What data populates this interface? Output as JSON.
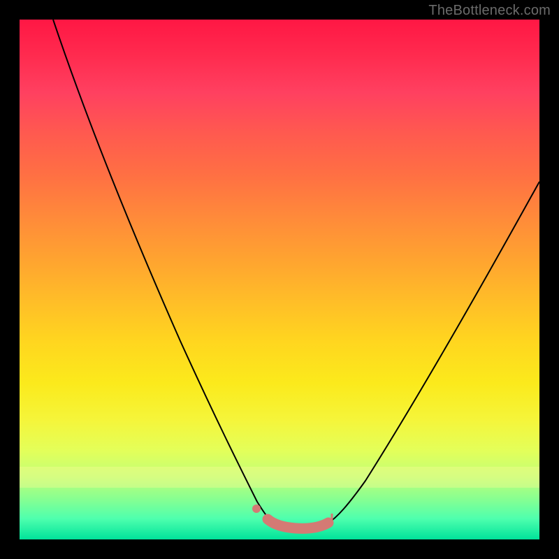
{
  "watermark": "TheBottleneck.com",
  "chart_data": {
    "type": "line",
    "title": "",
    "xlabel": "",
    "ylabel": "",
    "xlim": [
      0,
      100
    ],
    "ylim": [
      0,
      100
    ],
    "grid": false,
    "legend": false,
    "background": "heatmap-gradient-red-to-green-vertical",
    "series": [
      {
        "name": "bottleneck-curve",
        "color": "#000000",
        "x": [
          7,
          12,
          17,
          22,
          27,
          32,
          37,
          42,
          46,
          49,
          52,
          55,
          58,
          62,
          67,
          75,
          83,
          91,
          99
        ],
        "values": [
          100,
          87,
          75,
          62,
          50,
          38,
          27,
          16,
          8,
          4,
          2,
          2,
          4,
          8,
          15,
          27,
          41,
          55,
          69
        ]
      }
    ],
    "annotations": [
      {
        "type": "highlight-segment",
        "note": "optimal-range-marker",
        "color": "#d47a74",
        "x_start": 47,
        "x_end": 60,
        "y": 3
      },
      {
        "type": "dot",
        "color": "#d47a74",
        "x": 45.5,
        "y": 6
      }
    ]
  }
}
